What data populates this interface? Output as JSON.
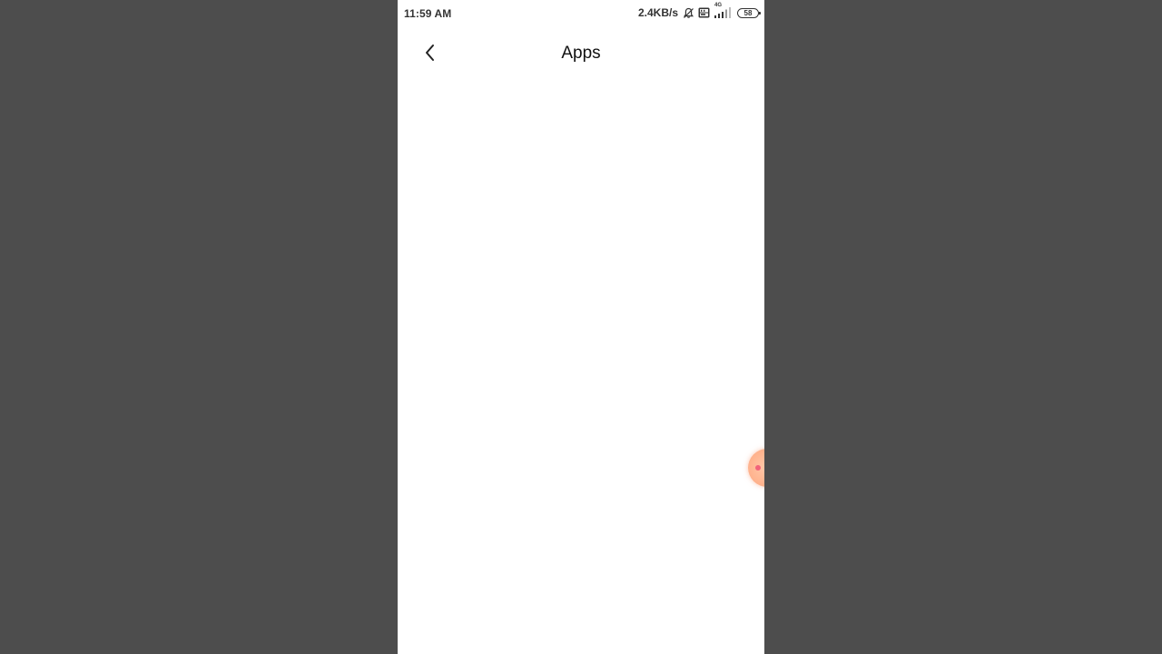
{
  "status_bar": {
    "time": "11:59 AM",
    "network_speed": "2.4KB/s",
    "signal_label": "4G",
    "battery": "58",
    "icons": [
      "bell-off-icon",
      "volte-icon",
      "signal-icon",
      "battery-icon"
    ]
  },
  "header": {
    "title": "Apps",
    "back_icon": "chevron-left-icon"
  },
  "colors": {
    "page_background": "#4d4d4d",
    "screen_background": "#ffffff",
    "bubble": "#ffb48f",
    "bubble_dot": "#f2637a"
  }
}
